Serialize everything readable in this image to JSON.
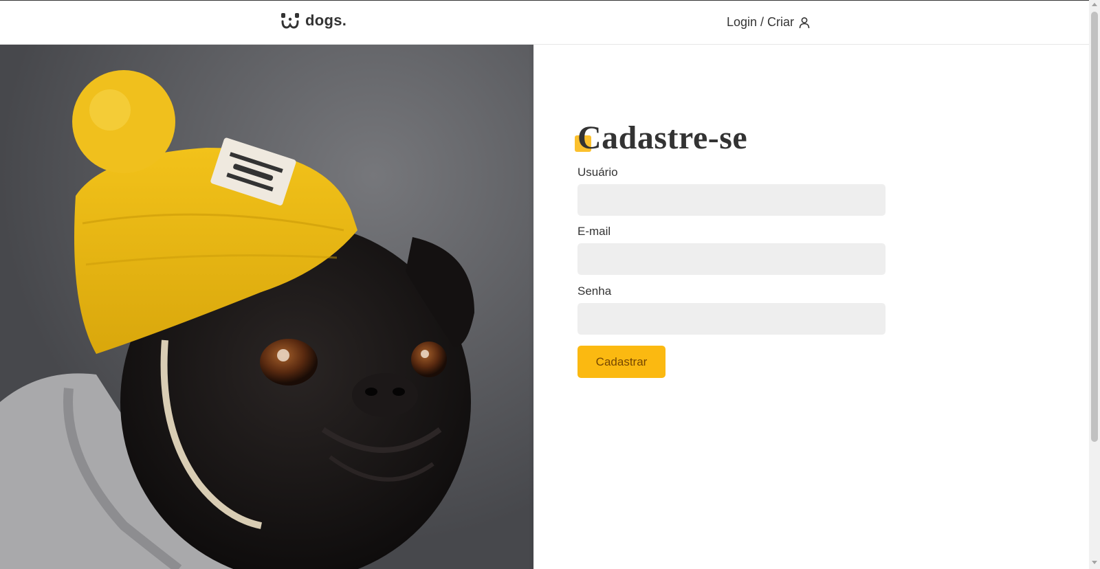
{
  "header": {
    "logo_text": "dogs.",
    "logo_icon": "dog-face-icon",
    "login_label": "Login / Criar",
    "login_icon": "user-icon"
  },
  "hero": {
    "photo_subject": "pug-with-yellow-beanie-photo"
  },
  "form": {
    "title": "Cadastre-se",
    "fields": [
      {
        "label": "Usuário",
        "value": "",
        "type": "text"
      },
      {
        "label": "E-mail",
        "value": "",
        "type": "email"
      },
      {
        "label": "Senha",
        "value": "",
        "type": "password"
      }
    ],
    "submit_label": "Cadastrar"
  },
  "colors": {
    "accent": "#fbb911",
    "accent_text": "#764701",
    "input_bg": "#eeeeee",
    "text": "#333333"
  }
}
